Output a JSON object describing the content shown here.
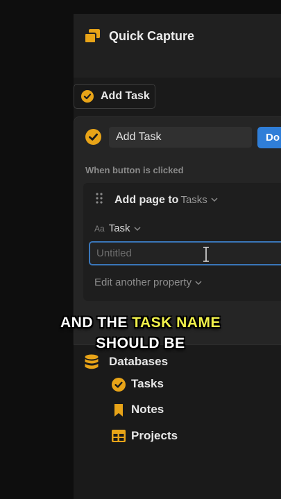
{
  "header": {
    "title": "Quick Capture",
    "icon": "stacked-pages-icon"
  },
  "button": {
    "label": "Add Task",
    "icon": "check-circle-icon"
  },
  "editor": {
    "name_value": "Add Task",
    "done_label": "Do",
    "when_label": "When button is clicked",
    "action": {
      "label": "Add page to",
      "target": "Tasks",
      "property_icon_text": "Aa",
      "property_name": "Task",
      "title_placeholder": "Untitled",
      "edit_another_label": "Edit another property"
    }
  },
  "caption": {
    "line1_pre": "AND THE ",
    "line1_highlight": "TASK NAME",
    "line2": "SHOULD BE"
  },
  "sidebar": {
    "section_label": "Databases",
    "items": [
      {
        "label": "Tasks",
        "icon": "check-circle-icon"
      },
      {
        "label": "Notes",
        "icon": "bookmark-icon"
      },
      {
        "label": "Projects",
        "icon": "table-icon"
      }
    ]
  },
  "colors": {
    "accent_gold": "#e8a418",
    "primary_blue": "#2f7ed8",
    "caption_highlight": "#f1f14a"
  }
}
